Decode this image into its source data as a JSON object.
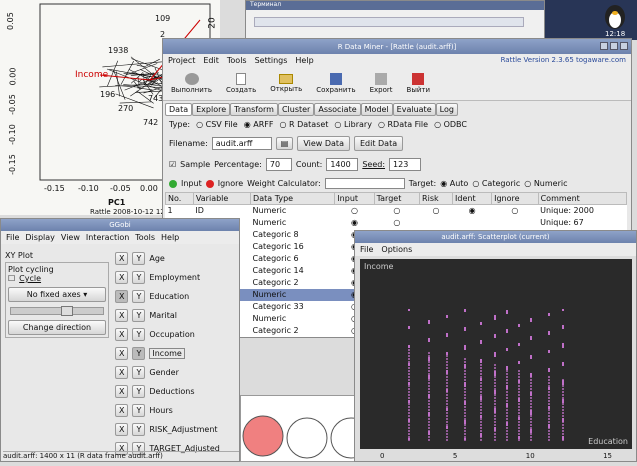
{
  "pca": {
    "yticks": [
      "0.05",
      "0.00",
      "-0.05",
      "-0.10",
      "-0.15"
    ],
    "xticks": [
      "-0.15",
      "-0.10",
      "-0.05",
      "0.00"
    ],
    "xlabel": "PC1",
    "caption": "Rattle 2008-10-12 12:06:0",
    "labels": [
      "109",
      "Income",
      "1938",
      "2",
      "196",
      "743",
      "270",
      "742",
      "20"
    ]
  },
  "term": {
    "title": "Терминал"
  },
  "clock": {
    "time": "12:18"
  },
  "rattle": {
    "title": "R Data Miner - [Rattle (audit.arff)]",
    "menu": [
      "Project",
      "Edit",
      "Tools",
      "Settings",
      "Help"
    ],
    "version": "Rattle Version 2.3.65 togaware.com",
    "toolbar": [
      "Выполнить",
      "Создать",
      "Открыть",
      "Сохранить",
      "Export",
      "Выйти"
    ],
    "tabs": [
      "Data",
      "Explore",
      "Transform",
      "Cluster",
      "Associate",
      "Model",
      "Evaluate",
      "Log"
    ],
    "type_label": "Type:",
    "types": [
      "CSV File",
      "ARFF",
      "R Dataset",
      "Library",
      "RData File",
      "ODBC"
    ],
    "filename_label": "Filename:",
    "filename": "audit.arff",
    "view_data": "View Data",
    "edit_data": "Edit Data",
    "sample_label": "Sample",
    "percentage_label": "Percentage:",
    "percentage": "70",
    "count_label": "Count:",
    "count": "1400",
    "seed_label": "Seed:",
    "seed": "123",
    "input_label": "Input",
    "ignore_label": "Ignore",
    "weight_label": "Weight Calculator:",
    "target_label": "Target:",
    "target_opts": [
      "Auto",
      "Categoric",
      "Numeric"
    ],
    "columns": [
      "No.",
      "Variable",
      "Data Type",
      "Input",
      "Target",
      "Risk",
      "Ident",
      "Ignore",
      "Comment"
    ],
    "rows": [
      [
        "1",
        "ID",
        "Numeric",
        "○",
        "○",
        "○",
        "◉",
        "○",
        "Unique: 2000"
      ],
      [
        "",
        "",
        "Numeric",
        "◉",
        "○",
        "",
        "",
        "",
        "Unique: 67"
      ],
      [
        "",
        "",
        "Categoric 8",
        "◉",
        "○",
        "",
        "",
        "",
        ""
      ],
      [
        "",
        "",
        "Categoric 16",
        "◉",
        "○",
        "",
        "",
        "",
        ""
      ],
      [
        "",
        "",
        "Categoric 6",
        "◉",
        "○",
        "",
        "",
        "",
        ""
      ],
      [
        "",
        "",
        "Categoric 14",
        "◉",
        "○",
        "",
        "",
        "",
        ""
      ],
      [
        "",
        "",
        "Categoric 2",
        "◉",
        "○",
        "",
        "",
        "",
        ""
      ],
      [
        "",
        "",
        "Numeric",
        "◉",
        "○",
        "",
        "",
        "",
        ""
      ],
      [
        "",
        "unts",
        "Categoric 33",
        "○",
        "○",
        "",
        "",
        "",
        ""
      ],
      [
        "",
        "ment",
        "Numeric",
        "○",
        "○",
        "",
        "",
        "",
        ""
      ],
      [
        "",
        "sted",
        "Categoric 2",
        "○",
        "○",
        "",
        "",
        "",
        ""
      ]
    ]
  },
  "ggobi": {
    "title": "GGobi",
    "menu": [
      "File",
      "Display",
      "View",
      "Interaction",
      "Tools",
      "Help"
    ],
    "plot_label": "XY Plot",
    "cycling_label": "Plot cycling",
    "cycle": "Cycle",
    "fixed_axes": "No fixed axes",
    "change_direction": "Change direction",
    "x": "X",
    "y": "Y",
    "vars": [
      "Age",
      "Employment",
      "Education",
      "Marital",
      "Occupation",
      "Income",
      "Gender",
      "Deductions",
      "Hours",
      "RISK_Adjustment",
      "TARGET_Adjusted"
    ],
    "status": "audit.arff: 1400 x 11 (R data frame audit.arff)"
  },
  "scatter": {
    "title": "audit.arff: Scatterplot (current)",
    "menu": [
      "File",
      "Options"
    ],
    "ylabel": "Income",
    "xlabel": "Education",
    "colors": {
      "bg": "#2a2a2a",
      "point": "#c070c8"
    },
    "ticks": [
      "0",
      "5",
      "10",
      "15"
    ]
  }
}
